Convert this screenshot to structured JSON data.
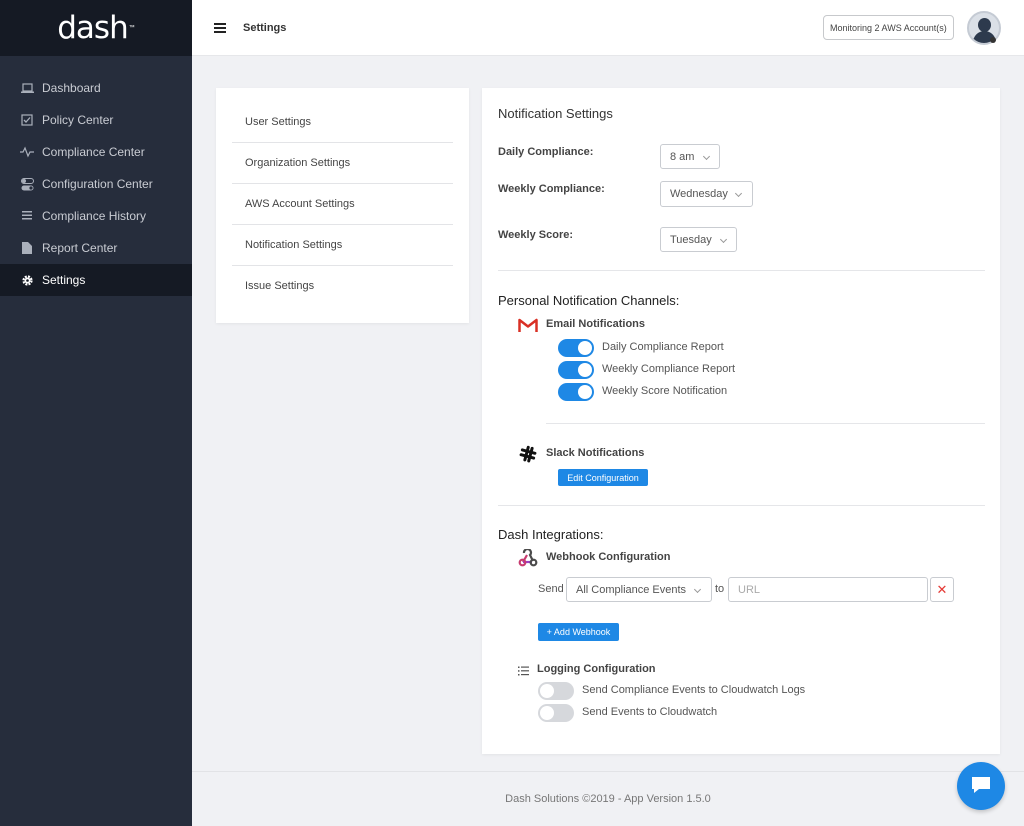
{
  "app": {
    "logo_text": "dash",
    "logo_mark": "™"
  },
  "sidebar": {
    "items": [
      {
        "label": "Dashboard",
        "icon": "laptop-icon"
      },
      {
        "label": "Policy Center",
        "icon": "checkbox-icon"
      },
      {
        "label": "Compliance Center",
        "icon": "pulse-icon"
      },
      {
        "label": "Configuration Center",
        "icon": "toggles-icon"
      },
      {
        "label": "Compliance History",
        "icon": "list-icon"
      },
      {
        "label": "Report Center",
        "icon": "document-icon"
      },
      {
        "label": "Settings",
        "icon": "gear-icon",
        "active": true
      }
    ]
  },
  "header": {
    "title": "Settings",
    "monitor_label": "Monitoring 2 AWS Account(s)"
  },
  "settings_menu": {
    "items": [
      "User Settings",
      "Organization Settings",
      "AWS Account Settings",
      "Notification Settings",
      "Issue Settings"
    ]
  },
  "notification_settings": {
    "title": "Notification Settings",
    "daily_label": "Daily Compliance:",
    "daily_value": "8 am",
    "weekly_label": "Weekly Compliance:",
    "weekly_value": "Wednesday",
    "score_label": "Weekly Score:",
    "score_value": "Tuesday"
  },
  "channels": {
    "title": "Personal Notification Channels:",
    "email_title": "Email Notifications",
    "email_toggles": [
      {
        "label": "Daily Compliance Report",
        "on": true
      },
      {
        "label": "Weekly Compliance Report",
        "on": true
      },
      {
        "label": "Weekly Score Notification",
        "on": true
      }
    ],
    "slack_title": "Slack Notifications",
    "slack_button": "Edit Configuration"
  },
  "integrations": {
    "title": "Dash Integrations:",
    "webhook_title": "Webhook Configuration",
    "send_label": "Send",
    "event_value": "All Compliance Events",
    "to_label": "to",
    "url_placeholder": "URL",
    "remove_symbol": "✕",
    "add_button": "+ Add Webhook",
    "logging_title": "Logging Configuration",
    "logging_toggles": [
      {
        "label": "Send Compliance Events to Cloudwatch Logs",
        "on": false
      },
      {
        "label": "Send Events to Cloudwatch",
        "on": false
      }
    ]
  },
  "footer": {
    "text": "Dash Solutions ©2019 - App Version 1.5.0"
  },
  "colors": {
    "accent": "#1e88e5",
    "sidebar": "#262d3c",
    "sidebar_dark": "#151a24"
  }
}
